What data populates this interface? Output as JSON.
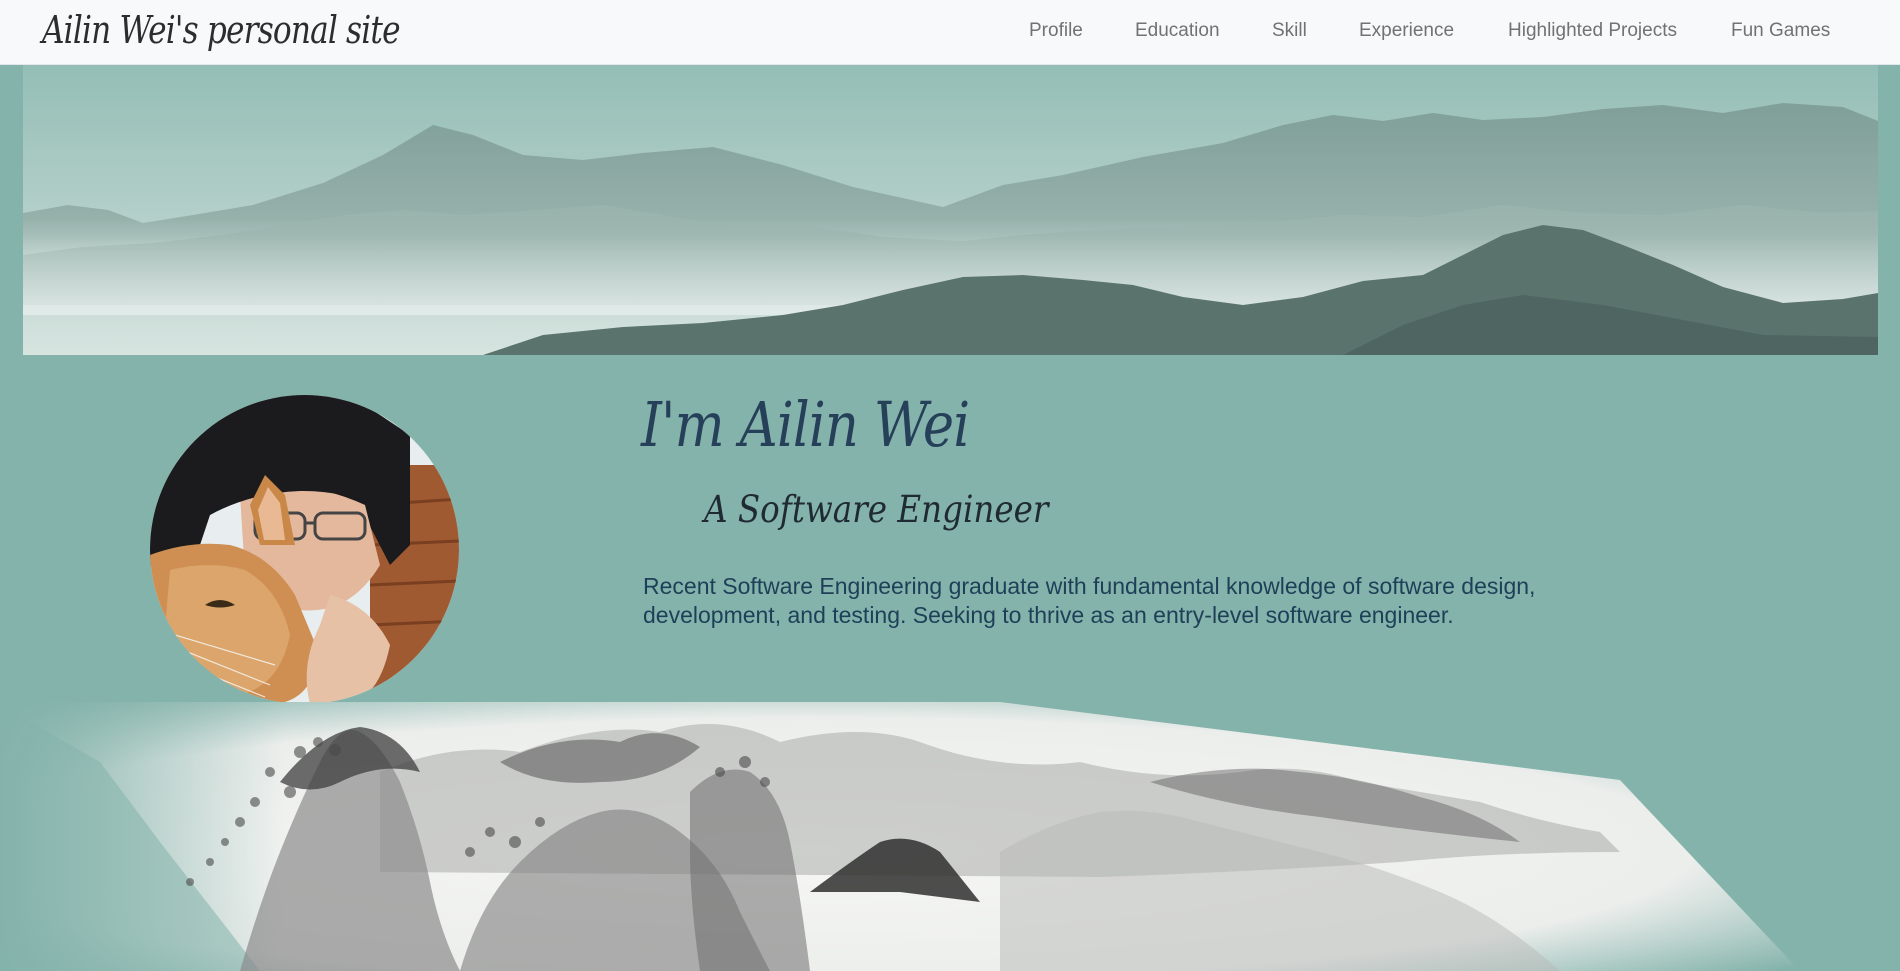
{
  "nav": {
    "brand": "Ailin Wei's personal site",
    "links": [
      {
        "label": "Profile"
      },
      {
        "label": "Education"
      },
      {
        "label": "Skill"
      },
      {
        "label": "Experience"
      },
      {
        "label": "Highlighted Projects"
      },
      {
        "label": "Fun Games"
      }
    ]
  },
  "profile": {
    "heading": "I'm Ailin Wei",
    "subheading": "A Software Engineer",
    "summary": "Recent Software Engineering graduate with fundamental knowledge of software design, development, and testing. Seeking to thrive as an entry-level software engineer."
  },
  "colors": {
    "page_background": "#84b3ab",
    "navbar_background": "#f8f9fa",
    "heading_text": "#26405a",
    "body_text": "#1e3f58"
  },
  "images": {
    "banner": "misty-mountains-landscape",
    "avatar": "portrait-with-orange-cat",
    "footer_painting": "ink-wash-mountain-painting"
  }
}
